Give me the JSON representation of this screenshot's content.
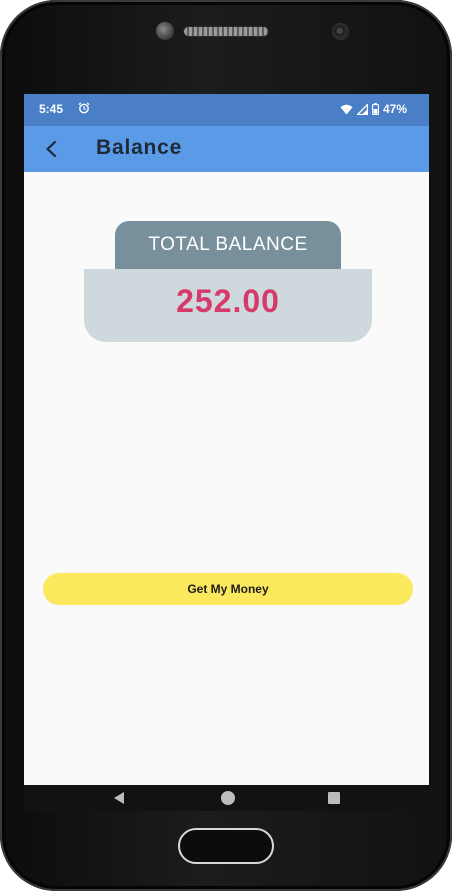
{
  "status_bar": {
    "time": "5:45",
    "battery_percent": "47%",
    "icons": [
      "alarm-icon",
      "wifi-icon",
      "signal-icon",
      "battery-icon"
    ]
  },
  "app_bar": {
    "title": "Balance",
    "back_icon": "back-arrow-icon"
  },
  "balance_card": {
    "label": "TOTAL BALANCE",
    "amount": "252.00",
    "amount_color": "#d63a6a"
  },
  "actions": {
    "get_money_label": "Get My Money",
    "button_color": "#fce85c"
  },
  "nav_bar": {
    "icons": [
      "nav-back-icon",
      "nav-home-icon",
      "nav-recents-icon"
    ]
  },
  "colors": {
    "status_bar": "#4a7fc7",
    "app_bar": "#5b9ae6",
    "card_tab": "#78909c",
    "card_body": "#cfd8dc"
  }
}
